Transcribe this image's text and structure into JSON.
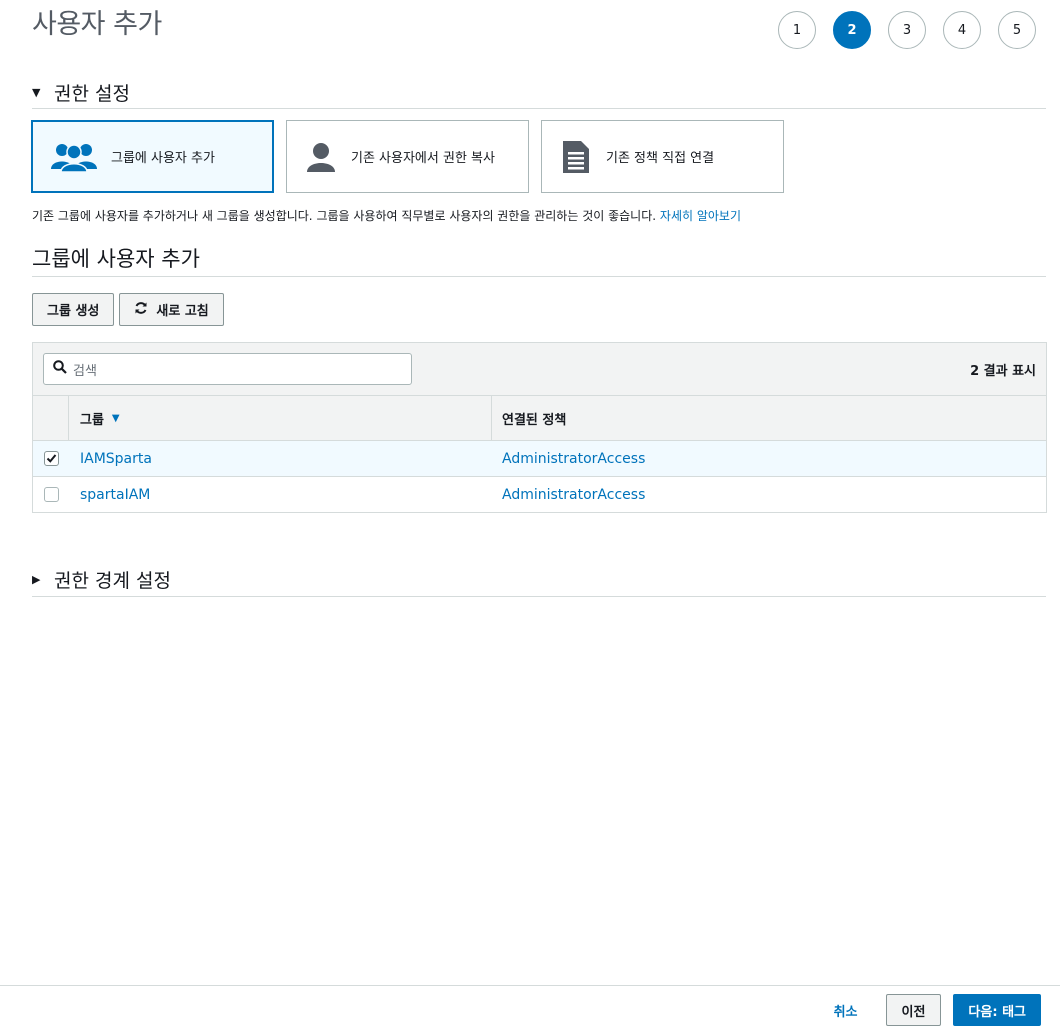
{
  "page_title": "사용자 추가",
  "steps": [
    "1",
    "2",
    "3",
    "4",
    "5"
  ],
  "active_step": "2",
  "permissions_section": {
    "title": "권한 설정"
  },
  "options": [
    {
      "label": "그룹에 사용자 추가",
      "icon": "group-icon",
      "selected": true
    },
    {
      "label": "기존 사용자에서 권한 복사",
      "icon": "user-icon",
      "selected": false
    },
    {
      "label": "기존 정책 직접 연결",
      "icon": "document-icon",
      "selected": false
    }
  ],
  "description": {
    "text": "기존 그룹에 사용자를 추가하거나 새 그룹을 생성합니다. 그룹을 사용하여 직무별로 사용자의 권한을 관리하는 것이 좋습니다.",
    "link": "자세히 알아보기"
  },
  "group_section": {
    "title": "그룹에 사용자 추가"
  },
  "toolbar": {
    "create_group": "그룹 생성",
    "refresh": "새로 고침"
  },
  "search": {
    "placeholder": "검색"
  },
  "result_count": "2 결과 표시",
  "table": {
    "columns": [
      "그룹",
      "연결된 정책"
    ],
    "rows": [
      {
        "group": "IAMSparta",
        "policy": "AdministratorAccess",
        "checked": true
      },
      {
        "group": "spartaIAM",
        "policy": "AdministratorAccess",
        "checked": false
      }
    ]
  },
  "boundary_section": {
    "title": "권한 경계 설정"
  },
  "footer": {
    "cancel": "취소",
    "previous": "이전",
    "next": "다음: 태그"
  },
  "colors": {
    "accent": "#0073bb",
    "selected_bg": "#f1faff",
    "border": "#aab7b8"
  }
}
